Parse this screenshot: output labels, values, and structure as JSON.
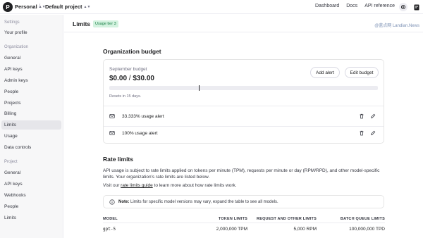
{
  "topbar": {
    "logo_letter": "P",
    "org_name": "Personal",
    "separator": "/",
    "project_name": "Default project",
    "nav": [
      "Dashboard",
      "Docs",
      "API reference"
    ]
  },
  "sidebar": {
    "settings_title": "Settings",
    "settings_items": [
      "Your profile"
    ],
    "organization_title": "Organization",
    "organization_items": [
      "General",
      "API keys",
      "Admin keys",
      "People",
      "Projects",
      "Billing",
      "Limits",
      "Usage",
      "Data controls"
    ],
    "project_title": "Project",
    "project_items": [
      "General",
      "API keys",
      "Webhooks",
      "People",
      "Limits"
    ],
    "active_item": "Limits"
  },
  "header": {
    "title": "Limits",
    "tier_badge": "Usage tier 3",
    "watermark": "@蓝点网 Landian.News"
  },
  "org_budget": {
    "heading": "Organization budget",
    "month_label": "September budget",
    "spent": "$0.00",
    "amount_separator": " / ",
    "limit": "$30.00",
    "progress_fraction": 0.0,
    "marker_fraction": 0.333,
    "resets_text": "Resets in 15 days.",
    "add_alert_label": "Add alert",
    "edit_budget_label": "Edit budget",
    "alerts": [
      "33.333% usage alert",
      "100% usage alert"
    ]
  },
  "rate_limits": {
    "heading": "Rate limits",
    "description": "API usage is subject to rate limits applied on tokens per minute (TPM), requests per minute or day (RPM/RPD), and other model-specific limits. Your organization's rate limits are listed below.",
    "visit_prefix": "Visit our ",
    "guide_link": "rate limits guide",
    "visit_suffix": " to learn more about how rate limits work.",
    "note_label": "Note:",
    "note_text": " Limits for specific model versions may vary, expand the table to see all models.",
    "columns": [
      "MODEL",
      "TOKEN LIMITS",
      "REQUEST AND OTHER LIMITS",
      "BATCH QUEUE LIMITS"
    ],
    "rows": [
      {
        "model": "gpt-5",
        "tokens": "2,000,000 TPM",
        "requests": "5,000 RPM",
        "batch": "100,000,000 TPD"
      }
    ]
  }
}
